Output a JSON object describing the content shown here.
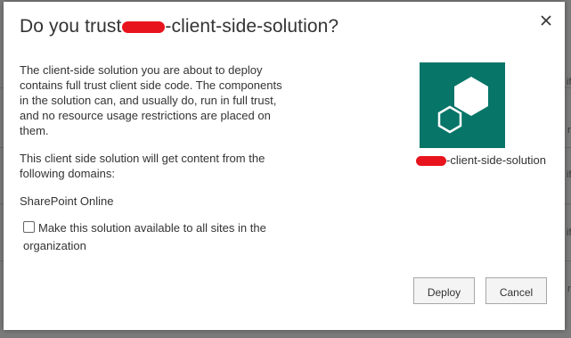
{
  "background": {
    "side_glyphs": [
      "ifi",
      "n",
      "ifi",
      "ifi",
      "n"
    ]
  },
  "dialog": {
    "title_prefix": "Do you trust",
    "title_suffix": "-client-side-solution?",
    "close_icon": "close-icon",
    "paragraph_1": "The client-side solution you are about to deploy contains full trust client side code. The components in the solution can, and usually do, run in full trust, and no resource usage restrictions are placed on them.",
    "paragraph_2": "This client side solution will get content from the following domains:",
    "domains": [
      "SharePoint Online"
    ],
    "checkbox": {
      "label": "Make this solution available to all sites in the organization",
      "checked": false
    },
    "solution_icon": "app-package-icon",
    "solution_name_suffix": "-client-side-solution",
    "tile_color": "#077568",
    "redaction_color": "#e8141d",
    "buttons": {
      "deploy": "Deploy",
      "cancel": "Cancel"
    }
  }
}
